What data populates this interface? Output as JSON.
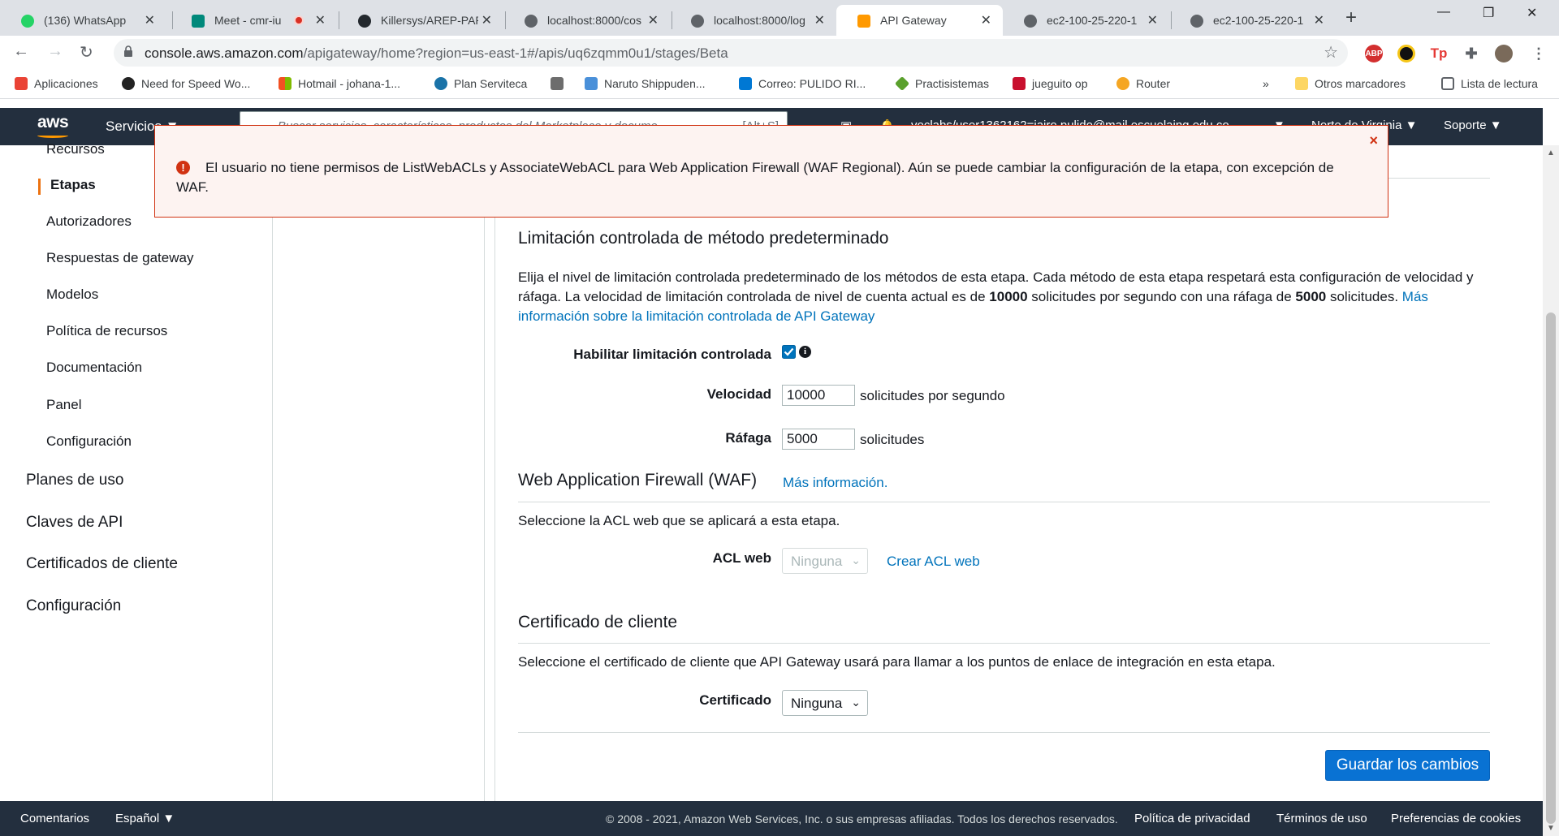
{
  "browser": {
    "tabs": [
      {
        "label": "(136) WhatsApp",
        "icon": "whatsapp-icon",
        "color": "#25d366"
      },
      {
        "label": "Meet - cmr-iu",
        "icon": "meet-icon",
        "color": "#00897b"
      },
      {
        "label": "Killersys/AREP-PAR",
        "icon": "github-icon",
        "color": "#24292e"
      },
      {
        "label": "localhost:8000/cos",
        "icon": "globe-icon",
        "color": "#5f6368"
      },
      {
        "label": "localhost:8000/log",
        "icon": "globe-icon",
        "color": "#5f6368"
      },
      {
        "label": "API Gateway",
        "icon": "aws-apigateway-icon",
        "color": "#ff9900"
      },
      {
        "label": "ec2-100-25-220-1",
        "icon": "globe-icon",
        "color": "#5f6368"
      },
      {
        "label": "ec2-100-25-220-1",
        "icon": "globe-icon",
        "color": "#5f6368"
      }
    ],
    "url_host": "console.aws.amazon.com",
    "url_path": "/apigateway/home?region=us-east-1#/apis/uq6zqmm0u1/stages/Beta",
    "bookmarks": [
      {
        "label": "Aplicaciones",
        "icon": "apps-grid-icon",
        "color": "#ea4335"
      },
      {
        "label": "Need for Speed Wo...",
        "icon": "ea-icon",
        "color": "#222222"
      },
      {
        "label": "Hotmail - johana-1...",
        "icon": "microsoft-icon",
        "color": "#f25022"
      },
      {
        "label": "Plan Serviteca",
        "icon": "serviteca-icon",
        "color": "#1a73a8"
      },
      {
        "label": "",
        "icon": "image-icon",
        "color": "#6d6d6d"
      },
      {
        "label": "Naruto Shippuden...",
        "icon": "triangle-icon",
        "color": "#4a90d9"
      },
      {
        "label": "Correo: PULIDO RI...",
        "icon": "outlook-icon",
        "color": "#0078d4"
      },
      {
        "label": "Practisistemas",
        "icon": "diamond-icon",
        "color": "#5aa02c"
      },
      {
        "label": "jueguito op",
        "icon": "k-icon",
        "color": "#c8102e"
      },
      {
        "label": "Router",
        "icon": "router-icon",
        "color": "#f5a623"
      }
    ],
    "other_bookmarks": "Otros marcadores",
    "reading_list": "Lista de lectura",
    "more_chevron": "»"
  },
  "aws_nav": {
    "logo": "aws",
    "services": "Servicios",
    "search_placeholder": "Buscar servicios, características, productos del Marketplace y docume",
    "search_shortcut": "[Alt+S]",
    "account": "voclabs/user1362162=jairo.pulido@mail.escuelaing.edu.co",
    "region": "Norte de Virginia",
    "support": "Soporte"
  },
  "sidebar": {
    "sub_items": [
      {
        "label": "Recursos"
      },
      {
        "label": "Etapas"
      },
      {
        "label": "Autorizadores"
      },
      {
        "label": "Respuestas de gateway"
      },
      {
        "label": "Modelos"
      },
      {
        "label": "Política de recursos"
      },
      {
        "label": "Documentación"
      },
      {
        "label": "Panel"
      },
      {
        "label": "Configuración"
      }
    ],
    "top_items": [
      {
        "label": "Planes de uso"
      },
      {
        "label": "Claves de API"
      },
      {
        "label": "Certificados de cliente"
      },
      {
        "label": "Configuración"
      }
    ]
  },
  "alert": {
    "message": "El usuario no tiene permisos de ListWebACLs y AssociateWebACL para Web Application Firewall (WAF Regional). Aún se puede cambiar la configuración de la etapa, con excepción de WAF.",
    "close": "×"
  },
  "throttling": {
    "title": "Limitación controlada de método predeterminado",
    "desc_1": "Elija el nivel de limitación controlada predeterminado de los métodos de esta etapa. Cada método de esta etapa respetará esta configuración de velocidad y ráfaga. La velocidad de limitación controlada de nivel de cuenta actual es de ",
    "rate_bold": "10000",
    "desc_2": " solicitudes por segundo con una ráfaga de ",
    "burst_bold": "5000",
    "desc_3": " solicitudes. ",
    "more_link": "Más información sobre la limitación controlada de API Gateway",
    "enable_label": "Habilitar limitación controlada",
    "enabled": true,
    "rate_label": "Velocidad",
    "rate_value": "10000",
    "rate_suffix": "solicitudes por segundo",
    "burst_label": "Ráfaga",
    "burst_value": "5000",
    "burst_suffix": "solicitudes"
  },
  "waf": {
    "title": "Web Application Firewall (WAF)",
    "more_link": "Más información.",
    "desc": "Seleccione la ACL web que se aplicará a esta etapa.",
    "acl_label": "ACL web",
    "acl_value": "Ninguna",
    "create_link": "Crear ACL web"
  },
  "client_cert": {
    "title": "Certificado de cliente",
    "desc": "Seleccione el certificado de cliente que API Gateway usará para llamar a los puntos de enlace de integración en esta etapa.",
    "cert_label": "Certificado",
    "cert_value": "Ninguna"
  },
  "save_button": "Guardar los cambios",
  "footer": {
    "feedback": "Comentarios",
    "language": "Español",
    "copyright": "© 2008 - 2021, Amazon Web Services, Inc. o sus empresas afiliadas. Todos los derechos reservados.",
    "privacy": "Política de privacidad",
    "terms": "Términos de uso",
    "cookies": "Preferencias de cookies"
  }
}
